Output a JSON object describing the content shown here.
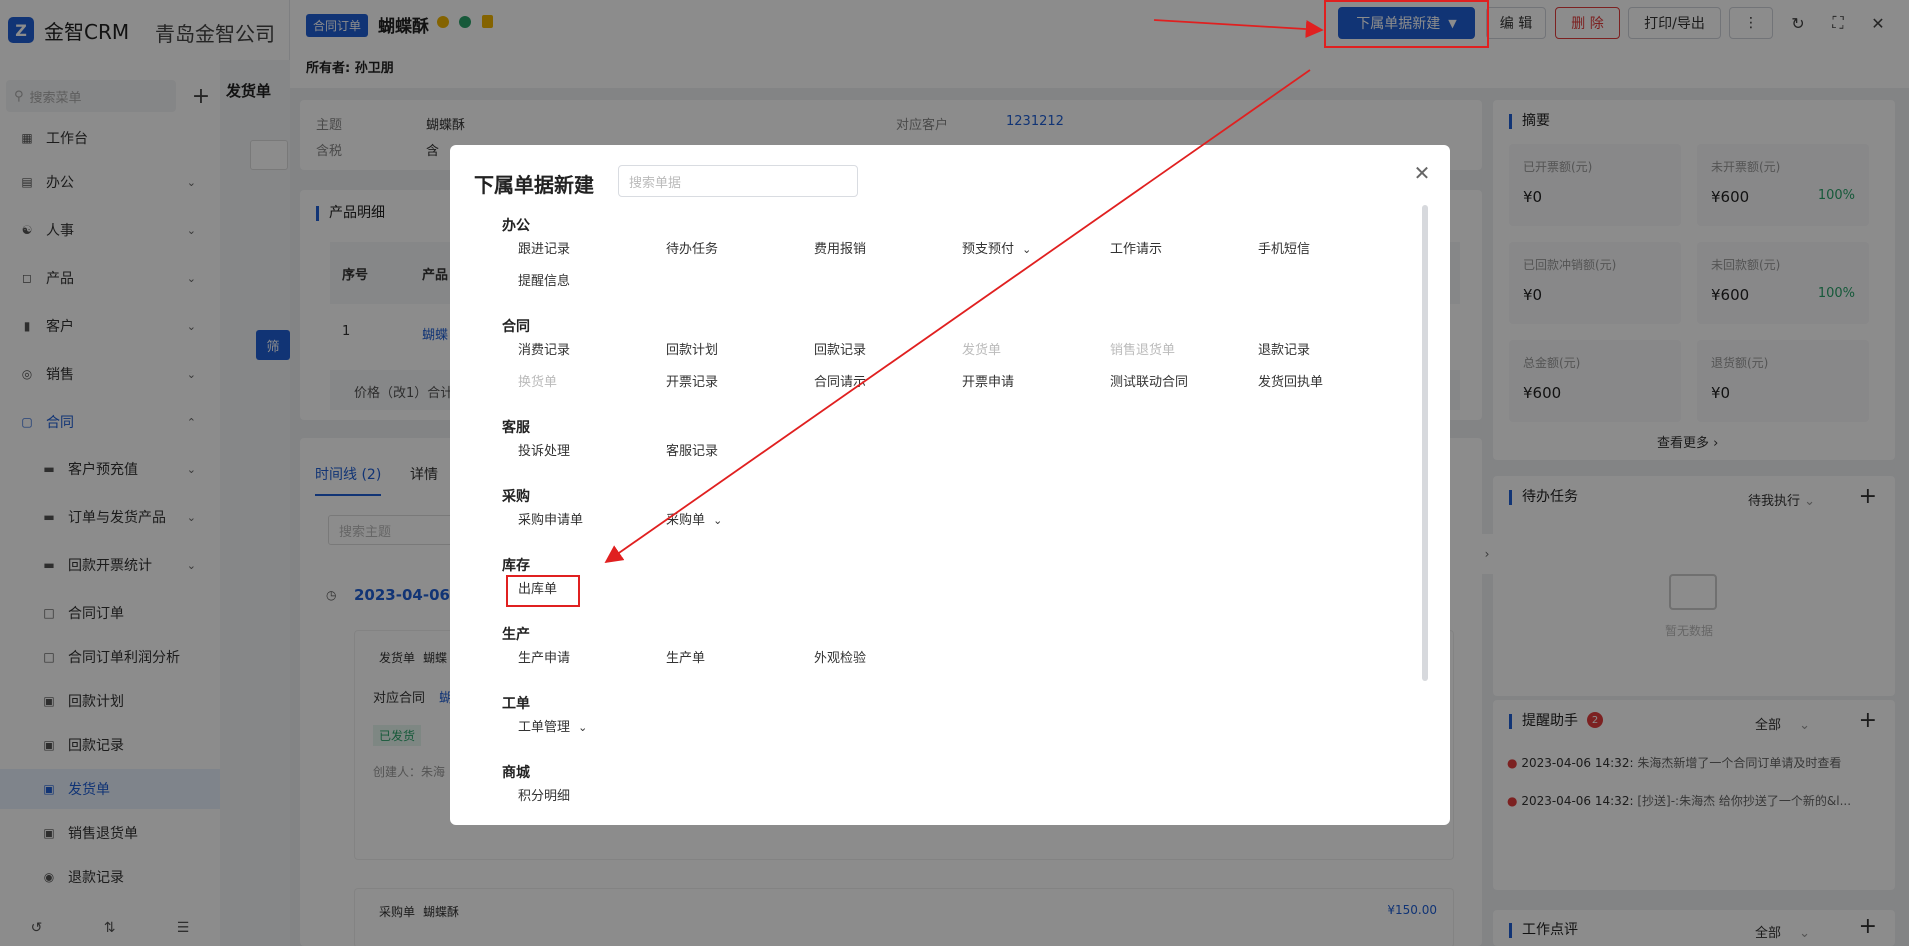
{
  "app": {
    "logo": "金智CRM",
    "company": "青岛金智公司"
  },
  "sidebar": {
    "search_placeholder": "搜索菜单",
    "items": [
      {
        "label": "工作台",
        "icon": "dashboard-icon"
      },
      {
        "label": "办公",
        "icon": "monitor-icon"
      },
      {
        "label": "人事",
        "icon": "people-icon"
      },
      {
        "label": "产品",
        "icon": "cube-icon"
      },
      {
        "label": "客户",
        "icon": "chart-icon"
      },
      {
        "label": "销售",
        "icon": "target-icon"
      },
      {
        "label": "合同",
        "icon": "document-icon"
      }
    ],
    "sub_items": [
      {
        "label": "客户预充值"
      },
      {
        "label": "订单与发货产品"
      },
      {
        "label": "回款开票统计"
      },
      {
        "label": "合同订单"
      },
      {
        "label": "合同订单利润分析"
      },
      {
        "label": "回款计划"
      },
      {
        "label": "回款记录"
      },
      {
        "label": "发货单"
      },
      {
        "label": "销售退货单"
      },
      {
        "label": "退款记录"
      }
    ]
  },
  "header": {
    "tag": "合同订单",
    "title": "蝴蝶酥",
    "owner_label": "所有者:",
    "owner": "孙卫朋",
    "buttons": {
      "new_sub": "下属单据新建",
      "edit": "编 辑",
      "delete": "删 除",
      "print": "打印/导出"
    }
  },
  "background": {
    "crumb": "发货单",
    "subject_label": "主题",
    "subject_value": "蝴蝶酥",
    "tax_label": "含税",
    "tax_value": "含",
    "customer_label": "对应客户",
    "customer_value": "1231212",
    "product_detail": "产品明细",
    "col_no": "序号",
    "col_product": "产品",
    "row_no": "1",
    "row_product": "蝴蝶",
    "price_text": "价格（改1）合计",
    "tab_timeline": "时间线 (2)",
    "tab_detail": "详情",
    "search_subject": "搜索主题",
    "date": "2023-04-06",
    "entry1_type": "发货单",
    "entry1_title": "蝴蝶",
    "entry1_contract": "对应合同",
    "entry1_contract_link": "蝴蝶",
    "entry1_status": "已发货",
    "entry1_creator": "创建人：朱海",
    "entry2_type": "采购单",
    "entry2_title": "蝴蝶酥",
    "entry2_amount": "¥150.00",
    "filter_btn": "筛"
  },
  "summary": {
    "title": "摘要",
    "boxes": [
      {
        "label": "已开票额(元)",
        "value": "¥0",
        "percent": ""
      },
      {
        "label": "未开票额(元)",
        "value": "¥600",
        "percent": "100%"
      },
      {
        "label": "已回款冲销额(元)",
        "value": "¥0",
        "percent": ""
      },
      {
        "label": "未回款额(元)",
        "value": "¥600",
        "percent": "100%"
      },
      {
        "label": "总金额(元)",
        "value": "¥600",
        "percent": ""
      },
      {
        "label": "退货额(元)",
        "value": "¥0",
        "percent": ""
      }
    ],
    "more": "查看更多"
  },
  "todo": {
    "title": "待办任务",
    "filter": "待我执行",
    "empty": "暂无数据"
  },
  "reminder": {
    "title": "提醒助手",
    "badge": "2",
    "filter": "全部",
    "items": [
      {
        "time": "2023-04-06 14:32:",
        "text": "朱海杰新增了一个合同订单请及时查看"
      },
      {
        "time": "2023-04-06 14:32:",
        "text": "[抄送]-:朱海杰 给你抄送了一个新的&l..."
      }
    ]
  },
  "review": {
    "title": "工作点评",
    "filter": "全部"
  },
  "modal": {
    "title": "下属单据新建",
    "search_placeholder": "搜索单据",
    "categories": [
      {
        "name": "办公",
        "items": [
          {
            "label": "跟进记录"
          },
          {
            "label": "待办任务"
          },
          {
            "label": "费用报销"
          },
          {
            "label": "预支预付",
            "dropdown": true
          },
          {
            "label": "工作请示"
          },
          {
            "label": "手机短信"
          },
          {
            "label": "提醒信息"
          }
        ]
      },
      {
        "name": "合同",
        "items": [
          {
            "label": "消费记录"
          },
          {
            "label": "回款计划"
          },
          {
            "label": "回款记录"
          },
          {
            "label": "发货单",
            "disabled": true
          },
          {
            "label": "销售退货单",
            "disabled": true
          },
          {
            "label": "退款记录"
          },
          {
            "label": "换货单",
            "disabled": true
          },
          {
            "label": "开票记录"
          },
          {
            "label": "合同请示"
          },
          {
            "label": "开票申请"
          },
          {
            "label": "测试联动合同"
          },
          {
            "label": "发货回执单"
          }
        ]
      },
      {
        "name": "客服",
        "items": [
          {
            "label": "投诉处理"
          },
          {
            "label": "客服记录"
          }
        ]
      },
      {
        "name": "采购",
        "items": [
          {
            "label": "采购申请单"
          },
          {
            "label": "采购单",
            "dropdown": true
          }
        ]
      },
      {
        "name": "库存",
        "items": [
          {
            "label": "出库单",
            "highlight": true
          }
        ]
      },
      {
        "name": "生产",
        "items": [
          {
            "label": "生产申请"
          },
          {
            "label": "生产单"
          },
          {
            "label": "外观检验"
          }
        ]
      },
      {
        "name": "工单",
        "items": [
          {
            "label": "工单管理",
            "dropdown": true
          }
        ]
      },
      {
        "name": "商城",
        "items": [
          {
            "label": "积分明细"
          }
        ]
      }
    ]
  },
  "colors": {
    "primary": "#1f5fd6",
    "danger": "#e23c3c",
    "annotation": "#e02020",
    "success": "#2aa36b"
  }
}
